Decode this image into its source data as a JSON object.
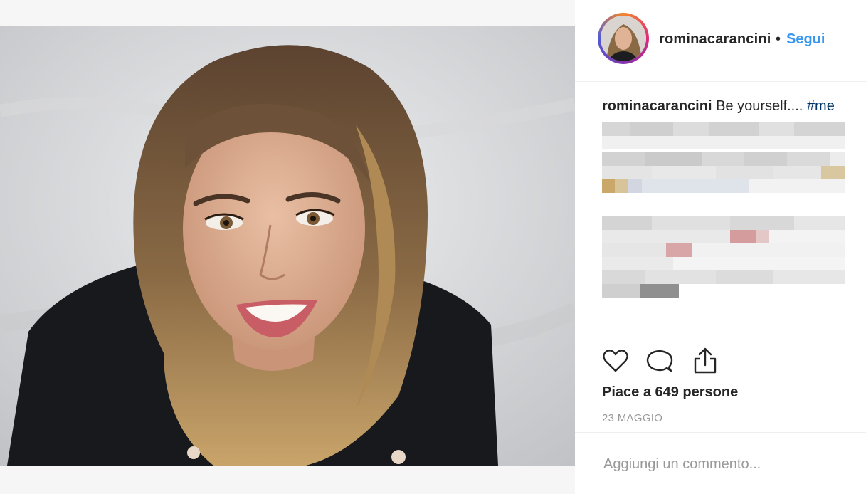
{
  "post": {
    "username": "rominacarancini",
    "separator": "•",
    "follow_label": "Segui"
  },
  "caption": {
    "username": "rominacarancini",
    "text": " Be yourself.... ",
    "hashtag": "#me"
  },
  "likes_text": "Piace a 649 persone",
  "date_text": "23 MAGGIO",
  "comment": {
    "placeholder": "Aggiungi un commento..."
  },
  "icons": {
    "like": "heart-icon",
    "comment": "comment-bubble-icon",
    "share": "share-icon"
  },
  "colors": {
    "accent": "#3897f0",
    "hashtag": "#003569",
    "text": "#262626",
    "muted": "#999999"
  }
}
